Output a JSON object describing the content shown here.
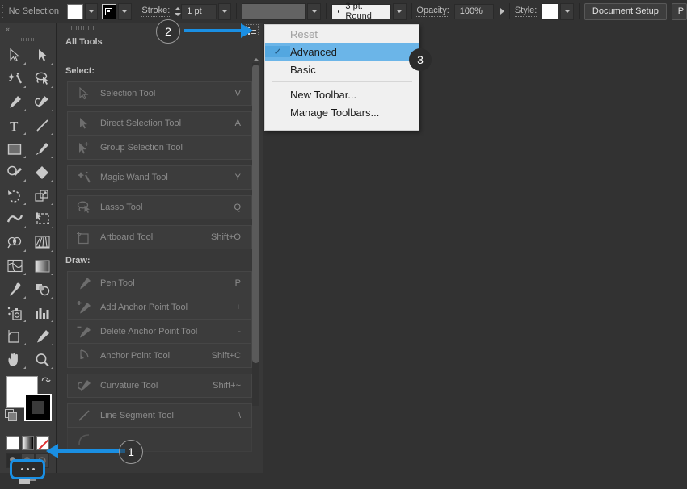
{
  "topbar": {
    "selection_status": "No Selection",
    "fill_swatch": "#ffffff",
    "stroke_swatch": "#000000",
    "stroke_label": "Stroke:",
    "stroke_weight": "1 pt",
    "variable_width_profile": "",
    "brush_definition": "3 pt. Round",
    "opacity_label": "Opacity:",
    "opacity_value": "100%",
    "style_label": "Style:",
    "document_setup_button": "Document Setup",
    "preferences_button": "P"
  },
  "panel": {
    "title": "All Tools",
    "menu_icon": "list-menu-icon",
    "groups": [
      {
        "label": "Select:",
        "blocks": [
          [
            {
              "name": "Selection Tool",
              "key": "V",
              "icon": "selection-arrow-icon"
            }
          ],
          [
            {
              "name": "Direct Selection Tool",
              "key": "A",
              "icon": "direct-selection-icon"
            },
            {
              "name": "Group Selection Tool",
              "key": "",
              "icon": "group-selection-icon"
            }
          ],
          [
            {
              "name": "Magic Wand Tool",
              "key": "Y",
              "icon": "magic-wand-icon"
            }
          ],
          [
            {
              "name": "Lasso Tool",
              "key": "Q",
              "icon": "lasso-icon"
            }
          ],
          [
            {
              "name": "Artboard Tool",
              "key": "Shift+O",
              "icon": "artboard-icon"
            }
          ]
        ]
      },
      {
        "label": "Draw:",
        "blocks": [
          [
            {
              "name": "Pen Tool",
              "key": "P",
              "icon": "pen-icon"
            },
            {
              "name": "Add Anchor Point Tool",
              "key": "+",
              "icon": "add-anchor-icon"
            },
            {
              "name": "Delete Anchor Point Tool",
              "key": "-",
              "icon": "delete-anchor-icon"
            },
            {
              "name": "Anchor Point Tool",
              "key": "Shift+C",
              "icon": "anchor-point-icon"
            }
          ],
          [
            {
              "name": "Curvature Tool",
              "key": "Shift+~",
              "icon": "curvature-icon"
            }
          ],
          [
            {
              "name": "Line Segment Tool",
              "key": "\\",
              "icon": "line-segment-icon"
            }
          ]
        ]
      }
    ]
  },
  "menu": {
    "items": [
      {
        "label": "Reset",
        "state": "disabled",
        "checked": false
      },
      {
        "label": "Advanced",
        "state": "selected",
        "checked": true
      },
      {
        "label": "Basic",
        "state": "normal",
        "checked": false
      },
      {
        "label": "---",
        "state": "separator",
        "checked": false
      },
      {
        "label": "New Toolbar...",
        "state": "normal",
        "checked": false
      },
      {
        "label": "Manage Toolbars...",
        "state": "normal",
        "checked": false
      }
    ],
    "check_glyph": "✓"
  },
  "toolbar_left": {
    "edit_toolbar_button": "edit-toolbar-ellipsis",
    "fill_color": "#ffffff",
    "stroke_color": "#000000",
    "highlight_color": "#1a8fe3"
  },
  "annotations": [
    {
      "id": "1",
      "label": "1",
      "style": "hollow"
    },
    {
      "id": "2",
      "label": "2",
      "style": "hollow"
    },
    {
      "id": "3",
      "label": "3",
      "style": "solid"
    }
  ]
}
